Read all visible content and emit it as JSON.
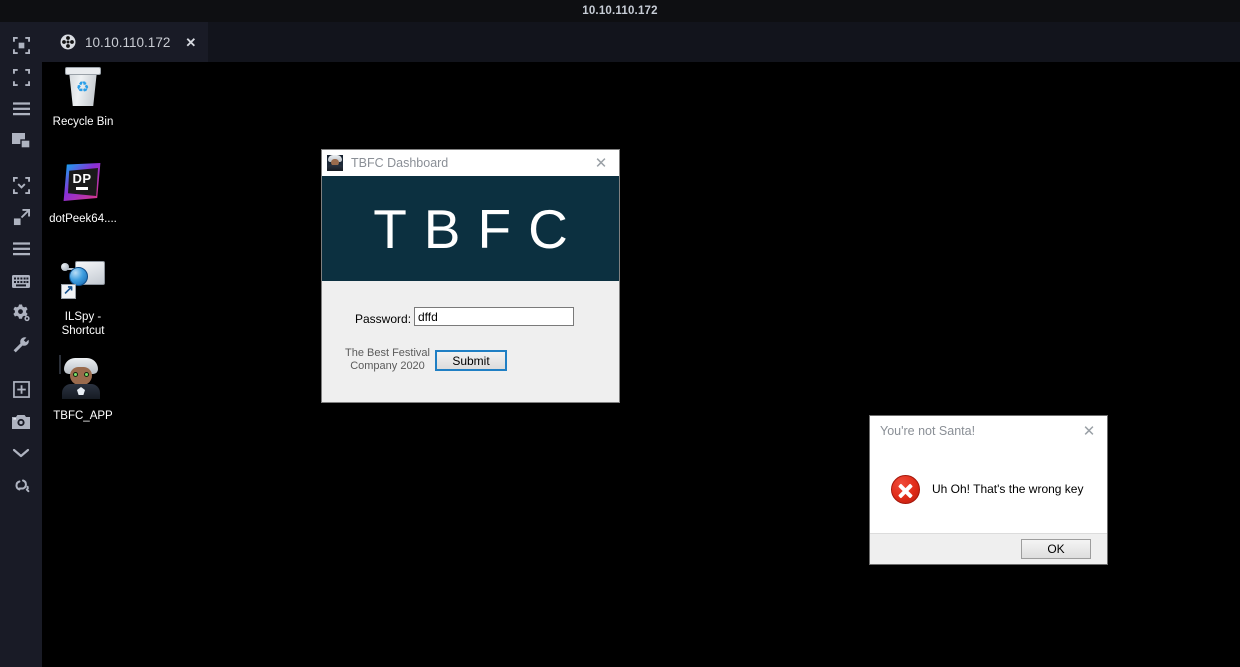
{
  "top_strip": {
    "title": "10.10.110.172"
  },
  "tab": {
    "favicon": "target-crosshair-icon",
    "label": "10.10.110.172",
    "close": "✕"
  },
  "sidebar": {
    "items": [
      {
        "name": "fit-to-window-icon",
        "tooltip": "Fit to window"
      },
      {
        "name": "fullscreen-icon",
        "tooltip": "Fullscreen"
      },
      {
        "name": "menu-icon",
        "tooltip": "Menu"
      },
      {
        "name": "multi-monitor-icon",
        "tooltip": "Displays"
      },
      {
        "name": "scale-to-fit-icon",
        "tooltip": "Scale to fit"
      },
      {
        "name": "expand-icon",
        "tooltip": "Expand"
      },
      {
        "name": "list-icon",
        "tooltip": "List"
      },
      {
        "name": "keyboard-icon",
        "tooltip": "Keyboard"
      },
      {
        "name": "settings-gear-icon",
        "tooltip": "Settings"
      },
      {
        "name": "wrench-icon",
        "tooltip": "Tools"
      },
      {
        "name": "add-panel-icon",
        "tooltip": "Add panel"
      },
      {
        "name": "camera-icon",
        "tooltip": "Screenshot"
      },
      {
        "name": "chevron-down-icon",
        "tooltip": "More"
      },
      {
        "name": "link-broken-icon",
        "tooltip": "Disconnect"
      }
    ]
  },
  "desktop": {
    "icons": [
      {
        "name": "recycle-bin",
        "label": "Recycle Bin"
      },
      {
        "name": "dotpeek-shortcut",
        "label": "dotPeek64...."
      },
      {
        "name": "ilspy-shortcut",
        "label": "ILSpy - Shortcut"
      },
      {
        "name": "tbfc-app",
        "label": "TBFC_APP"
      }
    ]
  },
  "tbfc_window": {
    "title": "TBFC Dashboard",
    "close": "✕",
    "banner_text": "TBFC",
    "password_label": "Password:",
    "password_value": "dffd",
    "password_placeholder": "",
    "footer_line1": "The Best Festival",
    "footer_line2": "Company 2020",
    "submit_label": "Submit",
    "banner_color": "#0c3040",
    "accent_color": "#1f7fc4"
  },
  "error_dialog": {
    "title": "You're not Santa!",
    "close": "✕",
    "message": "Uh Oh! That's the wrong key",
    "ok_label": "OK",
    "icon": "error-x-icon",
    "icon_color": "#e02b18"
  }
}
